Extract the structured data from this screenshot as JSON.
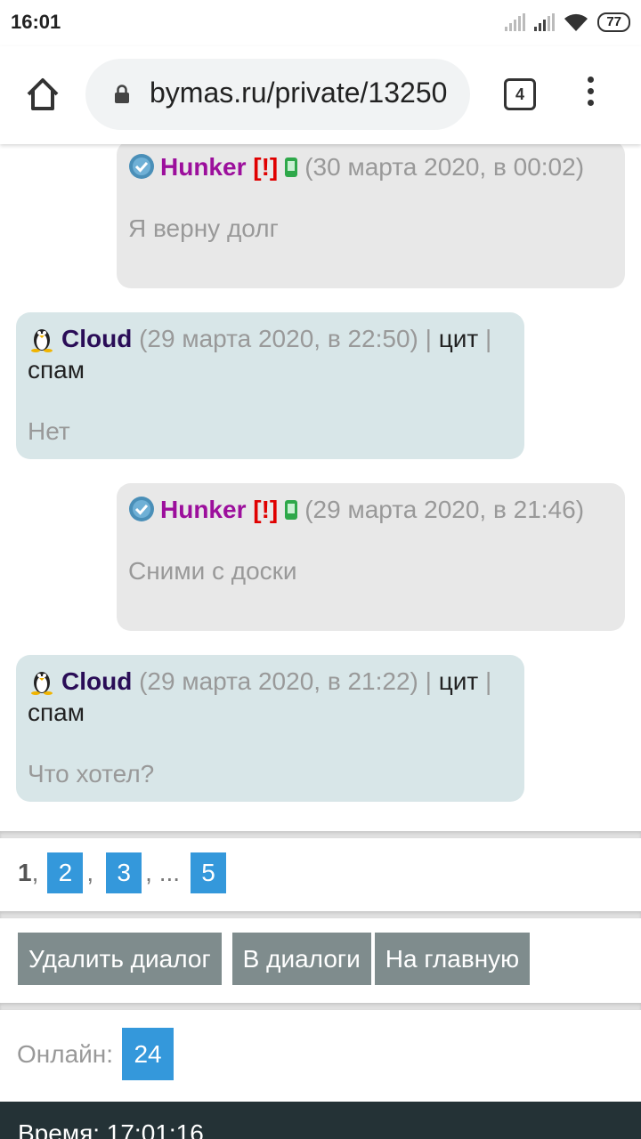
{
  "status_bar": {
    "time": "16:01",
    "battery": "77",
    "icons": [
      "signal-icon",
      "signal-icon",
      "wifi-icon",
      "battery-icon"
    ]
  },
  "browser": {
    "url": "bymas.ru/private/13250",
    "tab_count": "4",
    "icons": [
      "home-icon",
      "lock-icon",
      "tabs-icon",
      "menu-icon"
    ]
  },
  "messages": [
    {
      "side": "right",
      "user": "Hunker",
      "warning": "[!]",
      "date": "(30 марта 2020, в 00:02)",
      "text": "Я верну долг"
    },
    {
      "side": "left",
      "user": "Cloud",
      "date": "(29 марта 2020, в 22:50)",
      "sep": "|",
      "quote": "цит",
      "spam": "спам",
      "text": "Нет"
    },
    {
      "side": "right",
      "user": "Hunker",
      "warning": "[!]",
      "date": "(29 марта 2020, в 21:46)",
      "text": "Сними с доски"
    },
    {
      "side": "left",
      "user": "Cloud",
      "date": "(29 марта 2020, в 21:22)",
      "sep": "|",
      "quote": "цит",
      "spam": "спам",
      "text": "Что хотел?"
    }
  ],
  "pagination": {
    "current": "1",
    "comma": ",",
    "pages": [
      "2",
      "3",
      "5"
    ],
    "ellipsis": ", ..."
  },
  "actions": {
    "delete": "Удалить диалог",
    "dialogs": "В диалоги",
    "home": "На главную"
  },
  "online": {
    "label": "Онлайн:",
    "count": "24"
  },
  "footer": {
    "time_label": "Время: 17:01:16"
  },
  "colors": {
    "accent": "#3498db",
    "button": "#7f8c8d",
    "bubble_right": "#e8e8e8",
    "bubble_left": "#d8e6e8",
    "footer": "#243236"
  }
}
